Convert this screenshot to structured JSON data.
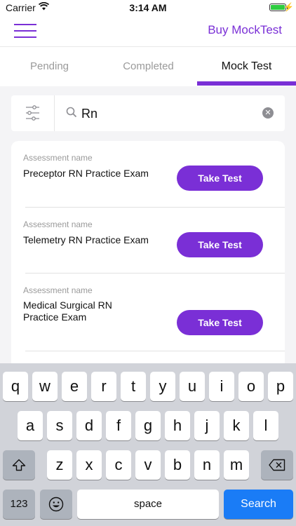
{
  "status_bar": {
    "carrier": "Carrier",
    "time": "3:14 AM"
  },
  "nav": {
    "buy_label": "Buy MockTest"
  },
  "tabs": [
    {
      "label": "Pending"
    },
    {
      "label": "Completed"
    },
    {
      "label": "Mock Test"
    }
  ],
  "search": {
    "value": "Rn",
    "clear_glyph": "✕"
  },
  "assessments": [
    {
      "caption": "Assessment name",
      "name": "Preceptor RN Practice Exam",
      "button": "Take Test"
    },
    {
      "caption": "Assessment name",
      "name": "Telemetry RN Practice Exam",
      "button": "Take Test"
    },
    {
      "caption": "Assessment name",
      "name": "Medical Surgical RN Practice Exam",
      "button": "Take Test"
    }
  ],
  "keyboard": {
    "row1": [
      "q",
      "w",
      "e",
      "r",
      "t",
      "y",
      "u",
      "i",
      "o",
      "p"
    ],
    "row2": [
      "a",
      "s",
      "d",
      "f",
      "g",
      "h",
      "j",
      "k",
      "l"
    ],
    "row3": [
      "z",
      "x",
      "c",
      "v",
      "b",
      "n",
      "m"
    ],
    "numbers_label": "123",
    "space_label": "space",
    "search_label": "Search"
  },
  "colors": {
    "accent": "#7a2fd6",
    "search_key": "#1a7cf6"
  }
}
